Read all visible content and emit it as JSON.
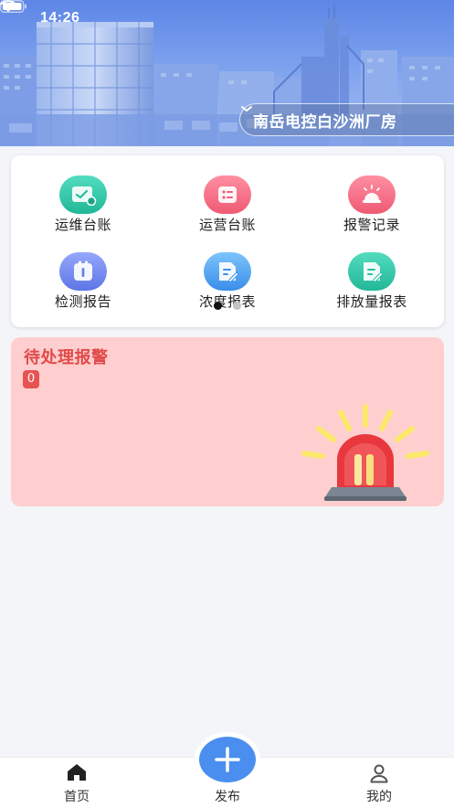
{
  "status_bar": {
    "time": "14:26"
  },
  "header": {
    "site_name": "南岳电控白沙洲厂房"
  },
  "grid": {
    "items": [
      {
        "label": "运维台账",
        "icon": "maintenance-ledger-icon",
        "color": "#2fc7a8"
      },
      {
        "label": "运营台账",
        "icon": "operation-ledger-icon",
        "color": "#f46c82"
      },
      {
        "label": "报警记录",
        "icon": "alarm-record-icon",
        "color": "#f46c82"
      },
      {
        "label": "检测报告",
        "icon": "inspection-report-icon",
        "color": "#6f86ee"
      },
      {
        "label": "浓度报表",
        "icon": "concentration-report-icon",
        "color": "#4aa0ef"
      },
      {
        "label": "排放量报表",
        "icon": "emission-report-icon",
        "color": "#2fc7a8"
      }
    ],
    "page_dots": {
      "count": 2,
      "active": 0
    }
  },
  "alarm": {
    "title": "待处理报警",
    "count": "0"
  },
  "tabbar": {
    "home": "首页",
    "publish": "发布",
    "mine": "我的"
  },
  "colors": {
    "accent": "#4a8ff0",
    "alarm_bg": "#ffcfcf",
    "alarm_text": "#e24a4a"
  }
}
